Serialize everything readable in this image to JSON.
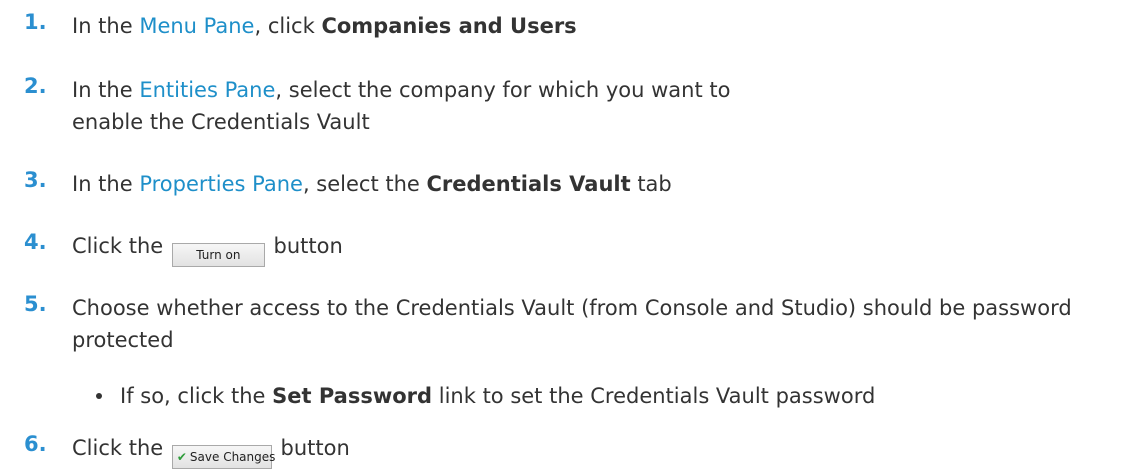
{
  "steps": [
    {
      "number": "1.",
      "parts": {
        "a": "In the ",
        "link": "Menu Pane",
        "b": ", click ",
        "bold": "Companies and Users"
      }
    },
    {
      "number": "2.",
      "parts": {
        "a": "In the ",
        "link": "Entities Pane",
        "b": ", select the company for which you want to enable the Credentials Vault"
      }
    },
    {
      "number": "3.",
      "parts": {
        "a": "In the ",
        "link": "Properties Pane",
        "b": ", select the ",
        "bold": "Credentials Vault",
        "c": " tab"
      }
    },
    {
      "number": "4.",
      "parts": {
        "a": "Click the ",
        "button": "Turn on",
        "b": " button"
      }
    },
    {
      "number": "5.",
      "parts": {
        "a": "Choose whether access to the Credentials Vault (from Console and Studio) should be password protected"
      },
      "bullet": {
        "a": "If so, click the ",
        "bold": "Set Password",
        "b": " link to set the Credentials Vault password"
      }
    },
    {
      "number": "6.",
      "parts": {
        "a": "Click the ",
        "button": "Save Changes",
        "b": " button"
      }
    }
  ],
  "colors": {
    "number": "#2b8fd0",
    "link": "#1e8fc9",
    "text": "#333333",
    "check": "#2e9c3a"
  },
  "icons": {
    "save_button_icon": "check-icon"
  }
}
